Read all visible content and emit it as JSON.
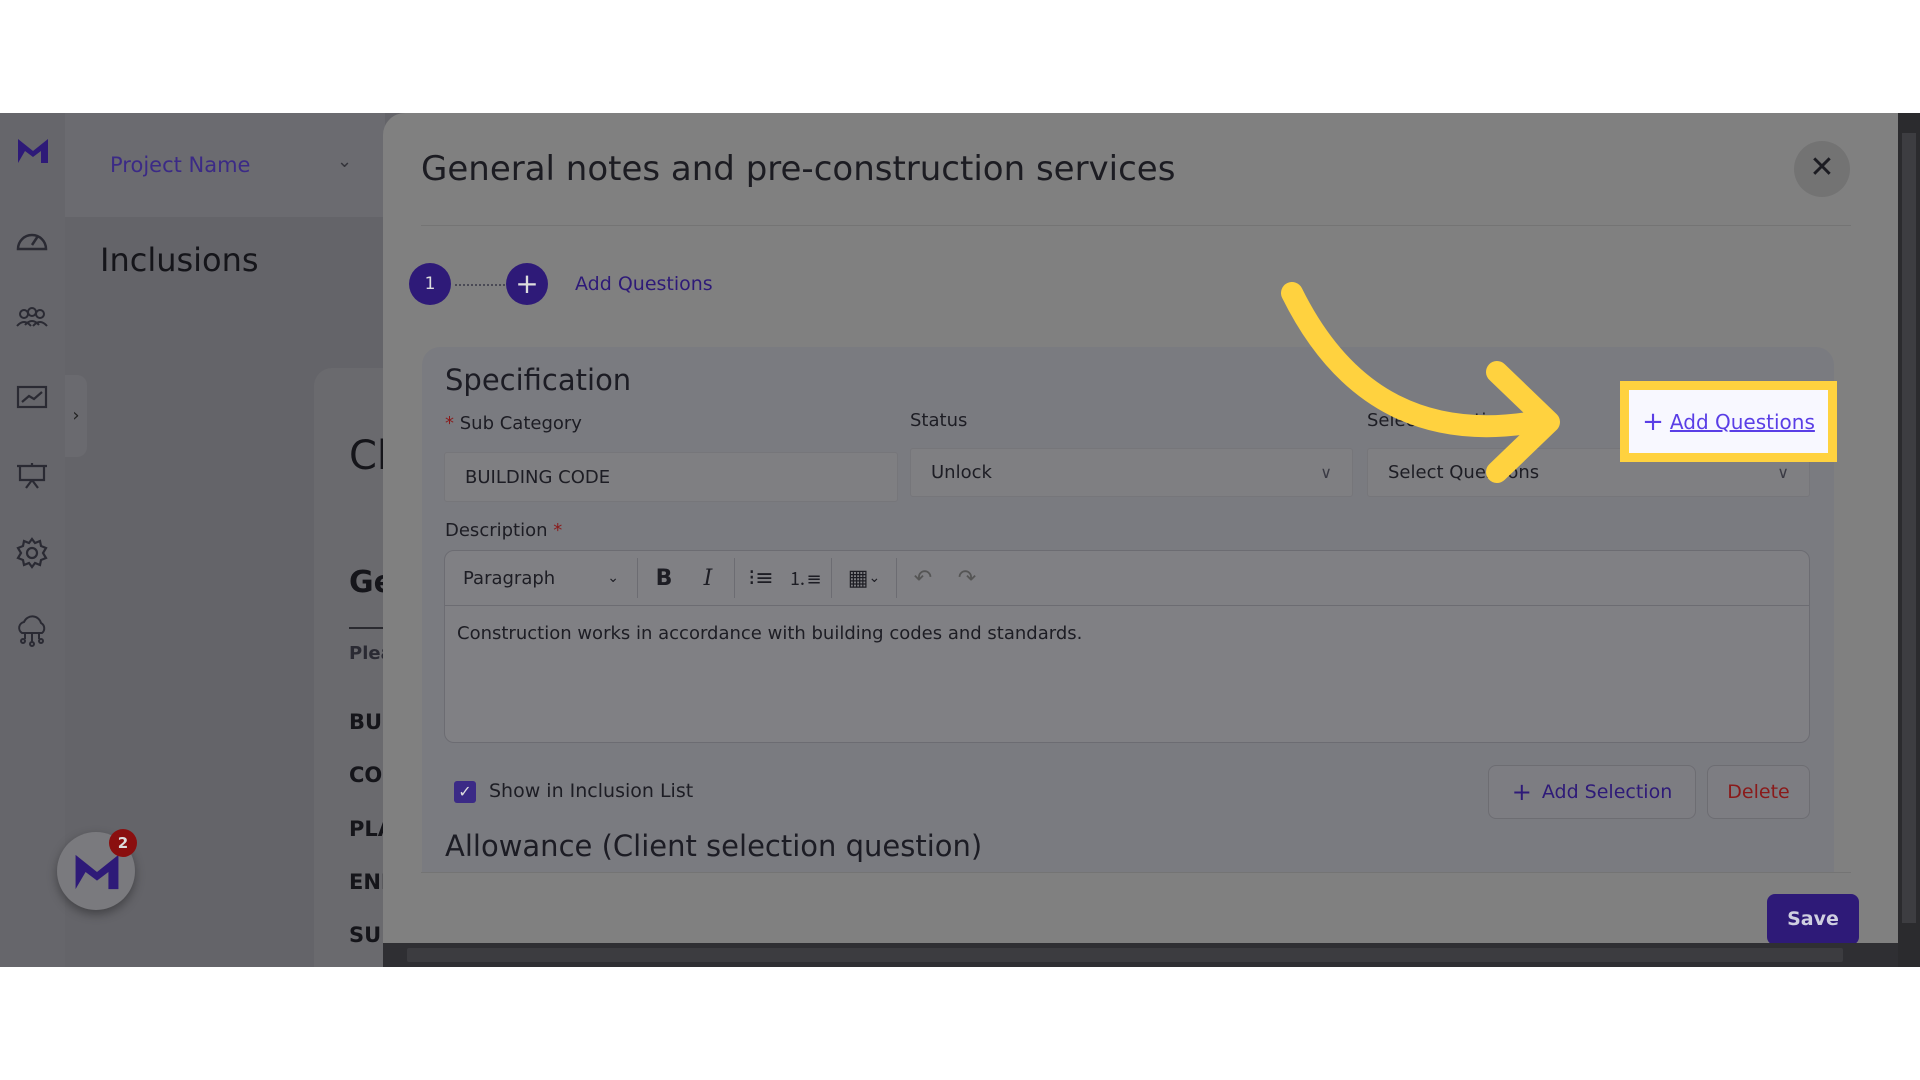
{
  "sidebar": {
    "icons": [
      "logo-icon",
      "dashboard-icon",
      "team-icon",
      "analytics-icon",
      "presentation-icon",
      "settings-icon",
      "cloud-network-icon"
    ]
  },
  "header": {
    "project_name": "Project Name"
  },
  "page": {
    "title": "Inclusions",
    "card_title_partial": "Cl",
    "section_partial": "Ge",
    "hint_partial": "Plea",
    "list_partial": [
      "BUI",
      "CO",
      "PLA",
      "ENE",
      "SUF"
    ]
  },
  "chat": {
    "badge_count": "2"
  },
  "modal": {
    "title": "General notes and pre-construction services",
    "stepper": {
      "step1": "1",
      "add_label": "Add Questions"
    },
    "specification": {
      "heading": "Specification",
      "sub_category_label": "Sub Category",
      "sub_category_value": "BUILDING CODE",
      "status_label": "Status",
      "status_value": "Unlock",
      "select_questions_label": "Select Questions",
      "select_questions_placeholder": "Select Questions",
      "add_questions_link": "Add Questions",
      "description_label": "Description",
      "editor": {
        "block_format": "Paragraph",
        "content": "Construction works in accordance with building codes and standards."
      },
      "show_in_list_label": "Show in Inclusion List",
      "show_in_list_checked": true,
      "add_selection_label": "Add Selection",
      "delete_label": "Delete"
    },
    "allowance_heading": "Allowance (Client selection question)",
    "save_label": "Save"
  },
  "colors": {
    "brand": "#2e1a78",
    "highlight": "#ffd23f",
    "link": "#5a3ee6",
    "danger": "#8a1a1a"
  }
}
